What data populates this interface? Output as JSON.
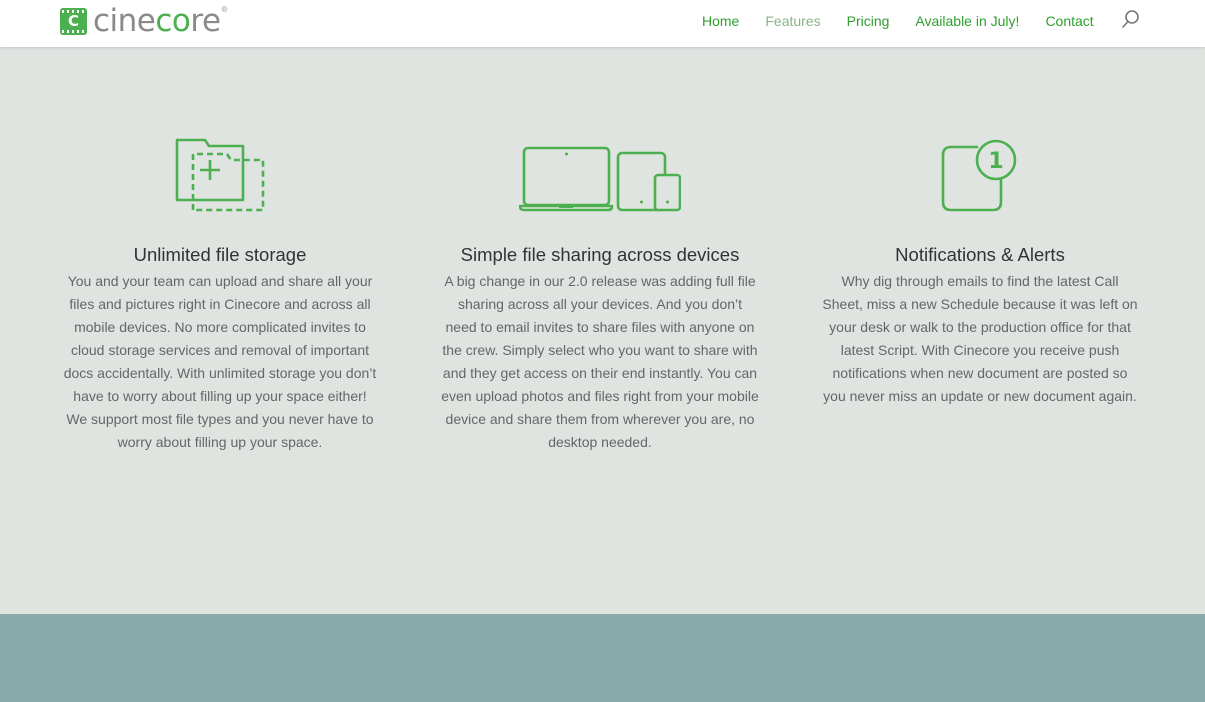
{
  "brand": {
    "mark_letter": "C",
    "name_gray1": "cine",
    "name_green": "co",
    "name_gray2": "re",
    "registered": "®",
    "accent_color": "#4caf50"
  },
  "nav": {
    "items": [
      {
        "label": "Home"
      },
      {
        "label": "Features"
      },
      {
        "label": "Pricing"
      },
      {
        "label": "Available in July!"
      },
      {
        "label": "Contact"
      }
    ],
    "active": "Features",
    "search_icon": "search-icon"
  },
  "features": [
    {
      "icon": "folder-add-icon",
      "title": "Unlimited file storage",
      "description": "You and your team can upload and share all your files and pictures right in Cinecore and across all mobile devices. No more complicated invites to cloud storage services and removal of important docs accidentally. With unlimited storage you don’t have to worry about filling up your space either! We support most file types and you never have to worry about filling up your space."
    },
    {
      "icon": "devices-icon",
      "title": "Simple file sharing across devices",
      "description": "A big change in our 2.0 release was adding full file sharing across all your devices. And you don’t need to email invites to share files with anyone on the crew. Simply select who you want to share with and they get access on their end instantly. You can even upload photos and files right from your mobile device and share them from wherever you are, no desktop needed."
    },
    {
      "icon": "notification-badge-icon",
      "badge": "1",
      "title": "Notifications & Alerts",
      "description": "Why dig through emails to find the latest Call Sheet, miss a new Schedule because it was left on your desk or walk to the production office for that latest Script. With Cinecore you receive push notifications when new document are posted so you never miss an update or new document again."
    }
  ]
}
